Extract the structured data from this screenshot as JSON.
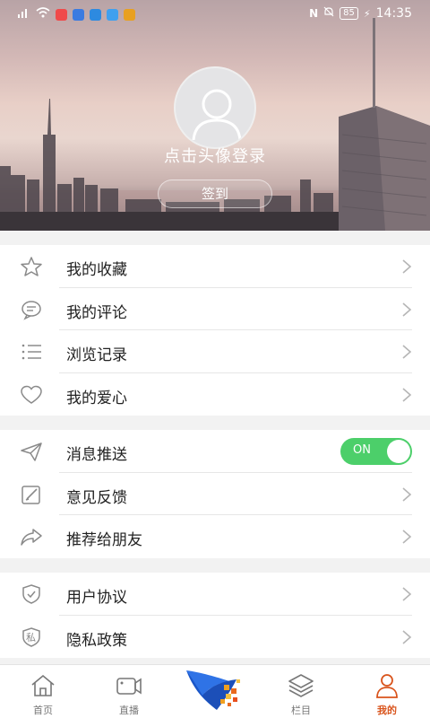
{
  "status_bar": {
    "time": "14:35",
    "battery": "85"
  },
  "profile": {
    "login_prompt": "点击头像登录",
    "signin_label": "签到"
  },
  "menu_group_1": [
    {
      "label": "我的收藏",
      "icon": "star-icon"
    },
    {
      "label": "我的评论",
      "icon": "comment-icon"
    },
    {
      "label": "浏览记录",
      "icon": "list-icon"
    },
    {
      "label": "我的爱心",
      "icon": "heart-icon"
    }
  ],
  "menu_group_2": [
    {
      "label": "消息推送",
      "icon": "send-icon",
      "toggle": "ON"
    },
    {
      "label": "意见反馈",
      "icon": "edit-icon"
    },
    {
      "label": "推荐给朋友",
      "icon": "share-icon"
    }
  ],
  "menu_group_3": [
    {
      "label": "用户协议",
      "icon": "shield-check-icon"
    },
    {
      "label": "隐私政策",
      "icon": "privacy-shield-icon",
      "badge": "私"
    }
  ],
  "tab_bar": {
    "tabs": [
      {
        "label": "首页",
        "icon": "home-icon"
      },
      {
        "label": "直播",
        "icon": "video-camera-icon"
      },
      {
        "label": "",
        "icon": "app-logo-icon"
      },
      {
        "label": "栏目",
        "icon": "layers-icon"
      },
      {
        "label": "我的",
        "icon": "user-icon",
        "active": true
      }
    ]
  },
  "colors": {
    "accent": "#d9541c",
    "toggle_on": "#4ccf6a"
  }
}
